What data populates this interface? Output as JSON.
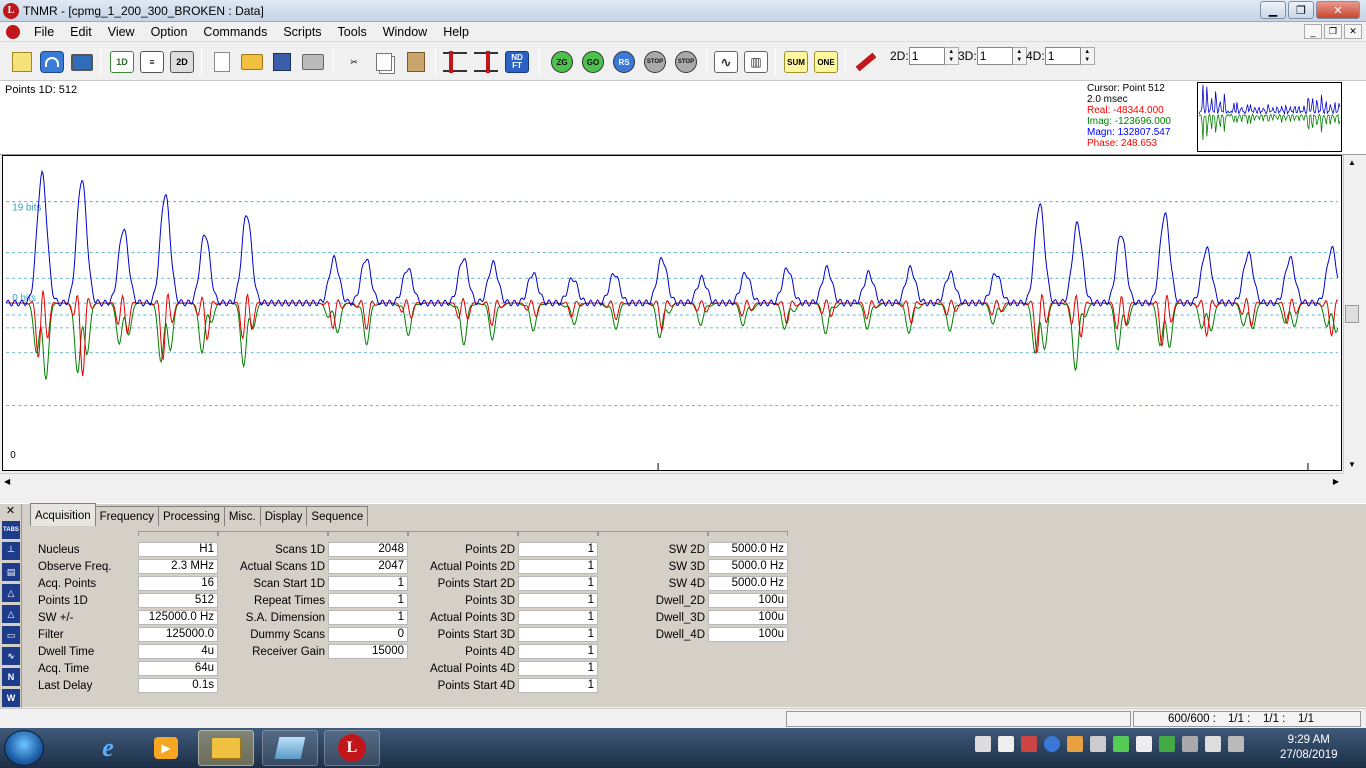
{
  "window": {
    "title": "TNMR - [cpmg_1_200_300_BROKEN : Data]",
    "app_icon_letter": "L"
  },
  "menu": [
    "File",
    "Edit",
    "View",
    "Option",
    "Commands",
    "Scripts",
    "Tools",
    "Window",
    "Help"
  ],
  "toolbar": {
    "buttons": [
      "notepad-icon",
      "gauge-icon",
      "monitor-icon",
      "1D",
      "stack-icon",
      "2D",
      "new-icon",
      "open-icon",
      "save-icon",
      "print-icon",
      "cut-icon",
      "copy-icon",
      "paste-icon",
      "slider-icon",
      "slider2-icon",
      "ND FT",
      "ZG",
      "GO",
      "RS",
      "STOP",
      "STOP",
      "wave-icon",
      "bars-icon",
      "SUM",
      "ONE",
      "hammer-icon"
    ],
    "dim_2d_label": "2D:",
    "dim_2d_value": "1",
    "dim_3d_label": "3D:",
    "dim_3d_value": "1",
    "dim_4d_label": "4D:",
    "dim_4d_value": "1"
  },
  "info": {
    "points_label": "Points 1D: 512",
    "cursor": "Cursor: Point 512",
    "time": "2.0 msec",
    "real": "Real: -48344.000",
    "imag": "Imag: -123696.000",
    "magn": "Magn: 132807.547",
    "phase": "Phase: 248.653",
    "real_color": "#ff0000",
    "imag_color": "#008000",
    "magn_color": "#0000ff",
    "phase_color": "#ff0000"
  },
  "plot": {
    "label_19bits": "19 bits",
    "label_0bits": "0 bits",
    "label_zero": "0",
    "gridline_color": "#3aa0b8",
    "label_color": "#3aa0b8"
  },
  "tabs": [
    "Acquisition",
    "Frequency",
    "Processing",
    "Misc.",
    "Display",
    "Sequence"
  ],
  "side_buttons": [
    "TABS",
    "┴",
    "▤",
    "△",
    "△",
    "▭",
    "∿",
    "N",
    "W"
  ],
  "params": {
    "col1": [
      {
        "label": "Nucleus",
        "value": "H1"
      },
      {
        "label": "Observe Freq.",
        "value": "2.3 MHz"
      },
      {
        "label": "Acq. Points",
        "value": "16"
      },
      {
        "label": "Points 1D",
        "value": "512"
      },
      {
        "label": "SW +/-",
        "value": "125000.0 Hz"
      },
      {
        "label": "Filter",
        "value": "125000.0"
      },
      {
        "label": "Dwell Time",
        "value": "4u"
      },
      {
        "label": "Acq. Time",
        "value": "64u"
      },
      {
        "label": "Last Delay",
        "value": "0.1s"
      }
    ],
    "col2": [
      {
        "label": "Scans 1D",
        "value": "2048"
      },
      {
        "label": "Actual Scans 1D",
        "value": "2047"
      },
      {
        "label": "Scan Start 1D",
        "value": "1"
      },
      {
        "label": "Repeat Times",
        "value": "1"
      },
      {
        "label": "S.A. Dimension",
        "value": "1"
      },
      {
        "label": "Dummy Scans",
        "value": "0"
      },
      {
        "label": "Receiver Gain",
        "value": "15000"
      }
    ],
    "col3": [
      {
        "label": "Points 2D",
        "value": "1"
      },
      {
        "label": "Actual Points 2D",
        "value": "1"
      },
      {
        "label": "Points Start 2D",
        "value": "1"
      },
      {
        "label": "Points 3D",
        "value": "1"
      },
      {
        "label": "Actual Points 3D",
        "value": "1"
      },
      {
        "label": "Points Start 3D",
        "value": "1"
      },
      {
        "label": "Points 4D",
        "value": "1"
      },
      {
        "label": "Actual Points 4D",
        "value": "1"
      },
      {
        "label": "Points Start 4D",
        "value": "1"
      }
    ],
    "col4": [
      {
        "label": "SW 2D",
        "value": "5000.0 Hz"
      },
      {
        "label": "SW 3D",
        "value": "5000.0 Hz"
      },
      {
        "label": "SW 4D",
        "value": "5000.0 Hz"
      },
      {
        "label": "Dwell_2D",
        "value": "100u"
      },
      {
        "label": "Dwell_3D",
        "value": "100u"
      },
      {
        "label": "Dwell_4D",
        "value": "100u"
      }
    ]
  },
  "status": {
    "counts": "600/600 :",
    "r1": "1/1 :",
    "r2": "1/1 :",
    "r3": "1/1"
  },
  "taskbar": {
    "time": "9:29 AM",
    "date": "27/08/2019"
  }
}
